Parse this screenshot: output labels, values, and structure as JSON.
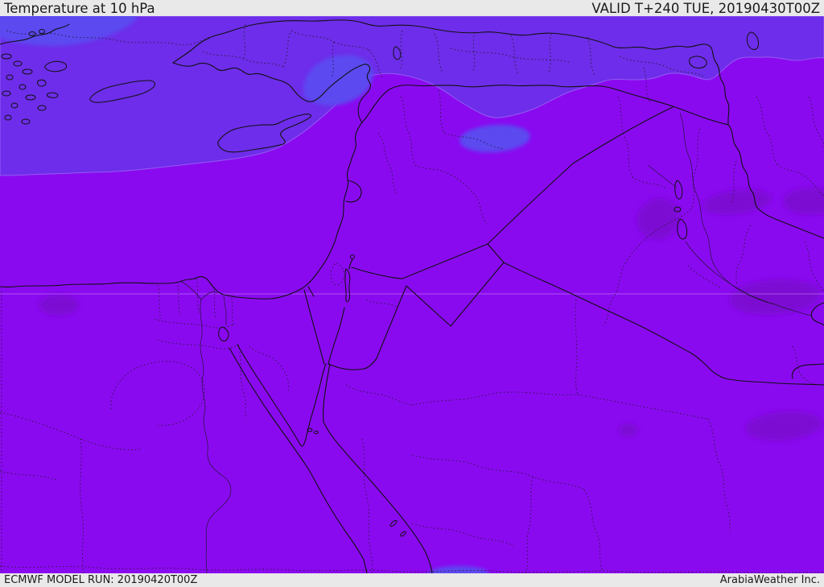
{
  "header": {
    "title": "Temperature at 10 hPa",
    "valid": "VALID T+240 TUE, 20190430T00Z"
  },
  "footer": {
    "model_run": "ECMWF MODEL RUN: 20190420T00Z",
    "credit": "ArabiaWeather Inc."
  },
  "map": {
    "parameter": "Temperature at 10 hPa",
    "colors": {
      "base_purple": "#8a0af0",
      "cool_band_purple": "#6e2dea",
      "cooler_patch_blue": "#5b48f0",
      "warmer_blob_purple": "#7c08d0",
      "border_line": "#141414",
      "bar_background": "#e9e9e9",
      "bar_text": "#1a1a1a"
    }
  }
}
